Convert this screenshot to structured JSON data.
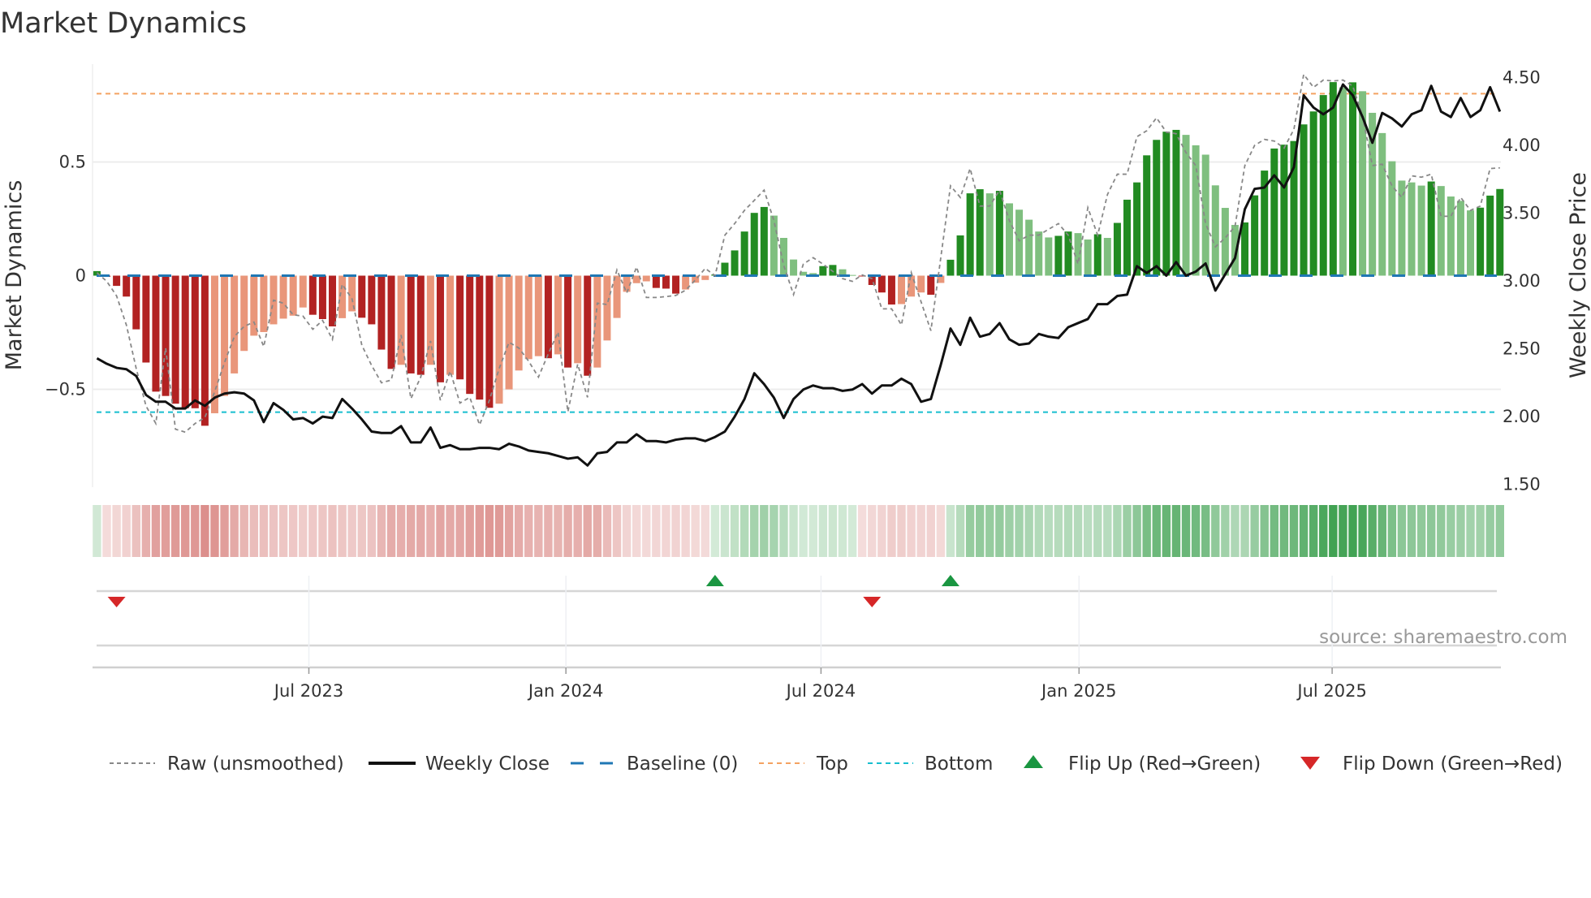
{
  "chart_data": {
    "type": "bar",
    "title": "Market Dynamics",
    "ylabel": "Market Dynamics",
    "ylabel_right": "Weekly Close Price",
    "ylim": [
      -0.93,
      0.93
    ],
    "ylim_right": [
      1.48,
      4.6
    ],
    "xlim_week_index": [
      -0.45,
      143.1
    ],
    "yticks": [
      {
        "value": 0.5,
        "label": "0.5"
      },
      {
        "value": 0,
        "label": "0"
      },
      {
        "value": -0.5,
        "label": "−0.5"
      }
    ],
    "yticks_right": [
      {
        "value": 4.5,
        "label": "4.50"
      },
      {
        "value": 4.0,
        "label": "4.00"
      },
      {
        "value": 3.5,
        "label": "3.50"
      },
      {
        "value": 3.0,
        "label": "3.00"
      },
      {
        "value": 2.5,
        "label": "2.50"
      },
      {
        "value": 2.0,
        "label": "2.00"
      },
      {
        "value": 1.5,
        "label": "1.50"
      }
    ],
    "xticks": [
      {
        "week_index": 21.6,
        "label": "Jul 2023"
      },
      {
        "week_index": 47.8,
        "label": "Jan 2024"
      },
      {
        "week_index": 73.8,
        "label": "Jul 2024"
      },
      {
        "week_index": 100.1,
        "label": "Jan 2025"
      },
      {
        "week_index": 125.9,
        "label": "Jul 2025"
      }
    ],
    "grid": true,
    "reference_lines": {
      "baseline": 0,
      "top": 0.8,
      "bottom": -0.6
    },
    "colors": {
      "green_dark": "#228b22",
      "green_light": "#7fbf7f",
      "red_dark": "#b22222",
      "red_light": "#e9967a",
      "close": "#111111",
      "raw": "#888888",
      "baseline": "#1f77b4",
      "top": "#f4a261",
      "bottom": "#17becf",
      "flip_up": "#1a9641",
      "flip_down": "#d62728"
    },
    "smoothed": [
      0.02,
      -0.005,
      -0.045,
      -0.092,
      -0.236,
      -0.382,
      -0.51,
      -0.529,
      -0.563,
      -0.583,
      -0.583,
      -0.66,
      -0.605,
      -0.529,
      -0.43,
      -0.331,
      -0.264,
      -0.248,
      -0.214,
      -0.189,
      -0.176,
      -0.14,
      -0.172,
      -0.191,
      -0.223,
      -0.187,
      -0.157,
      -0.185,
      -0.214,
      -0.325,
      -0.41,
      -0.392,
      -0.43,
      -0.436,
      -0.392,
      -0.469,
      -0.436,
      -0.456,
      -0.52,
      -0.545,
      -0.581,
      -0.563,
      -0.5,
      -0.417,
      -0.367,
      -0.354,
      -0.363,
      -0.346,
      -0.404,
      -0.385,
      -0.44,
      -0.404,
      -0.285,
      -0.186,
      -0.071,
      -0.033,
      -0.025,
      -0.054,
      -0.057,
      -0.079,
      -0.061,
      -0.031,
      -0.019,
      0.005,
      0.057,
      0.111,
      0.194,
      0.276,
      0.302,
      0.264,
      0.166,
      0.071,
      0.017,
      0.011,
      0.042,
      0.047,
      0.028,
      0.003,
      -0.002,
      -0.041,
      -0.074,
      -0.127,
      -0.125,
      -0.092,
      -0.074,
      -0.084,
      -0.032,
      0.07,
      0.177,
      0.362,
      0.38,
      0.362,
      0.373,
      0.318,
      0.29,
      0.246,
      0.194,
      0.168,
      0.175,
      0.194,
      0.187,
      0.159,
      0.182,
      0.166,
      0.232,
      0.334,
      0.41,
      0.529,
      0.597,
      0.633,
      0.641,
      0.619,
      0.573,
      0.532,
      0.397,
      0.298,
      0.223,
      0.234,
      0.353,
      0.462,
      0.559,
      0.576,
      0.592,
      0.665,
      0.722,
      0.794,
      0.851,
      0.828,
      0.85,
      0.811,
      0.716,
      0.627,
      0.503,
      0.418,
      0.41,
      0.396,
      0.414,
      0.394,
      0.348,
      0.329,
      0.287,
      0.299,
      0.352,
      0.381
    ],
    "raw": [
      0.013,
      -0.025,
      -0.089,
      -0.217,
      -0.408,
      -0.573,
      -0.65,
      -0.318,
      -0.675,
      -0.688,
      -0.65,
      -0.624,
      -0.51,
      -0.382,
      -0.268,
      -0.223,
      -0.204,
      -0.312,
      -0.108,
      -0.121,
      -0.172,
      -0.178,
      -0.236,
      -0.197,
      -0.28,
      -0.038,
      -0.102,
      -0.306,
      -0.395,
      -0.471,
      -0.459,
      -0.261,
      -0.541,
      -0.446,
      -0.287,
      -0.548,
      -0.42,
      -0.56,
      -0.535,
      -0.656,
      -0.548,
      -0.408,
      -0.293,
      -0.318,
      -0.376,
      -0.446,
      -0.344,
      -0.248,
      -0.599,
      -0.389,
      -0.535,
      -0.121,
      -0.127,
      0.025,
      -0.076,
      0.038,
      -0.096,
      -0.096,
      -0.092,
      -0.087,
      -0.064,
      -0.019,
      0.032,
      0.0,
      0.178,
      0.229,
      0.287,
      0.331,
      0.376,
      0.242,
      0.045,
      -0.083,
      0.051,
      0.079,
      0.051,
      0.019,
      -0.013,
      -0.025,
      0.003,
      -0.013,
      -0.146,
      -0.146,
      -0.217,
      0.013,
      -0.115,
      -0.242,
      0.076,
      0.395,
      0.344,
      0.471,
      0.306,
      0.306,
      0.376,
      0.242,
      0.153,
      0.178,
      0.178,
      0.204,
      0.229,
      0.178,
      0.051,
      0.299,
      0.178,
      0.357,
      0.446,
      0.446,
      0.611,
      0.637,
      0.694,
      0.631,
      0.624,
      0.541,
      0.484,
      0.229,
      0.127,
      0.166,
      0.217,
      0.484,
      0.573,
      0.599,
      0.592,
      0.561,
      0.643,
      0.885,
      0.828,
      0.86,
      0.856,
      0.86,
      0.834,
      0.701,
      0.484,
      0.49,
      0.395,
      0.344,
      0.439,
      0.433,
      0.446,
      0.261,
      0.261,
      0.344,
      0.287,
      0.306,
      0.471,
      0.474
    ],
    "close": [
      2.43,
      2.39,
      2.36,
      2.35,
      2.3,
      2.16,
      2.11,
      2.11,
      2.06,
      2.06,
      2.12,
      2.08,
      2.14,
      2.17,
      2.18,
      2.17,
      2.12,
      1.96,
      2.1,
      2.05,
      1.98,
      1.99,
      1.95,
      2.0,
      1.99,
      2.13,
      2.06,
      1.98,
      1.89,
      1.88,
      1.88,
      1.93,
      1.81,
      1.81,
      1.92,
      1.77,
      1.79,
      1.76,
      1.76,
      1.77,
      1.77,
      1.76,
      1.8,
      1.78,
      1.75,
      1.74,
      1.73,
      1.71,
      1.69,
      1.7,
      1.64,
      1.73,
      1.74,
      1.81,
      1.81,
      1.87,
      1.82,
      1.82,
      1.81,
      1.83,
      1.84,
      1.84,
      1.82,
      1.85,
      1.89,
      2.0,
      2.13,
      2.32,
      2.24,
      2.14,
      1.99,
      2.13,
      2.2,
      2.23,
      2.21,
      2.21,
      2.19,
      2.2,
      2.24,
      2.17,
      2.23,
      2.23,
      2.28,
      2.24,
      2.11,
      2.13,
      2.38,
      2.65,
      2.53,
      2.73,
      2.59,
      2.61,
      2.69,
      2.57,
      2.53,
      2.54,
      2.61,
      2.59,
      2.58,
      2.66,
      2.69,
      2.72,
      2.83,
      2.83,
      2.89,
      2.9,
      3.11,
      3.06,
      3.11,
      3.04,
      3.14,
      3.04,
      3.07,
      3.13,
      2.93,
      3.05,
      3.17,
      3.53,
      3.68,
      3.69,
      3.78,
      3.69,
      3.84,
      4.37,
      4.28,
      4.23,
      4.28,
      4.45,
      4.37,
      4.21,
      4.02,
      4.24,
      4.2,
      4.14,
      4.23,
      4.26,
      4.44,
      4.25,
      4.21,
      4.35,
      4.21,
      4.26,
      4.43,
      4.25
    ],
    "flips": [
      {
        "week_index": 2,
        "type": "down"
      },
      {
        "week_index": 63,
        "type": "up"
      },
      {
        "week_index": 79,
        "type": "down"
      },
      {
        "week_index": 87,
        "type": "up"
      }
    ],
    "legend": {
      "placement": "bottom",
      "items": [
        {
          "key": "raw",
          "label": "Raw (unsmoothed)"
        },
        {
          "key": "close",
          "label": "Weekly Close"
        },
        {
          "key": "baseline",
          "label": "Baseline (0)"
        },
        {
          "key": "top",
          "label": "Top"
        },
        {
          "key": "bottom",
          "label": "Bottom"
        },
        {
          "key": "flip_up",
          "label": "Flip Up (Red→Green)"
        },
        {
          "key": "flip_down",
          "label": "Flip Down (Green→Red)"
        }
      ]
    },
    "source": "source: sharemaestro.com"
  }
}
